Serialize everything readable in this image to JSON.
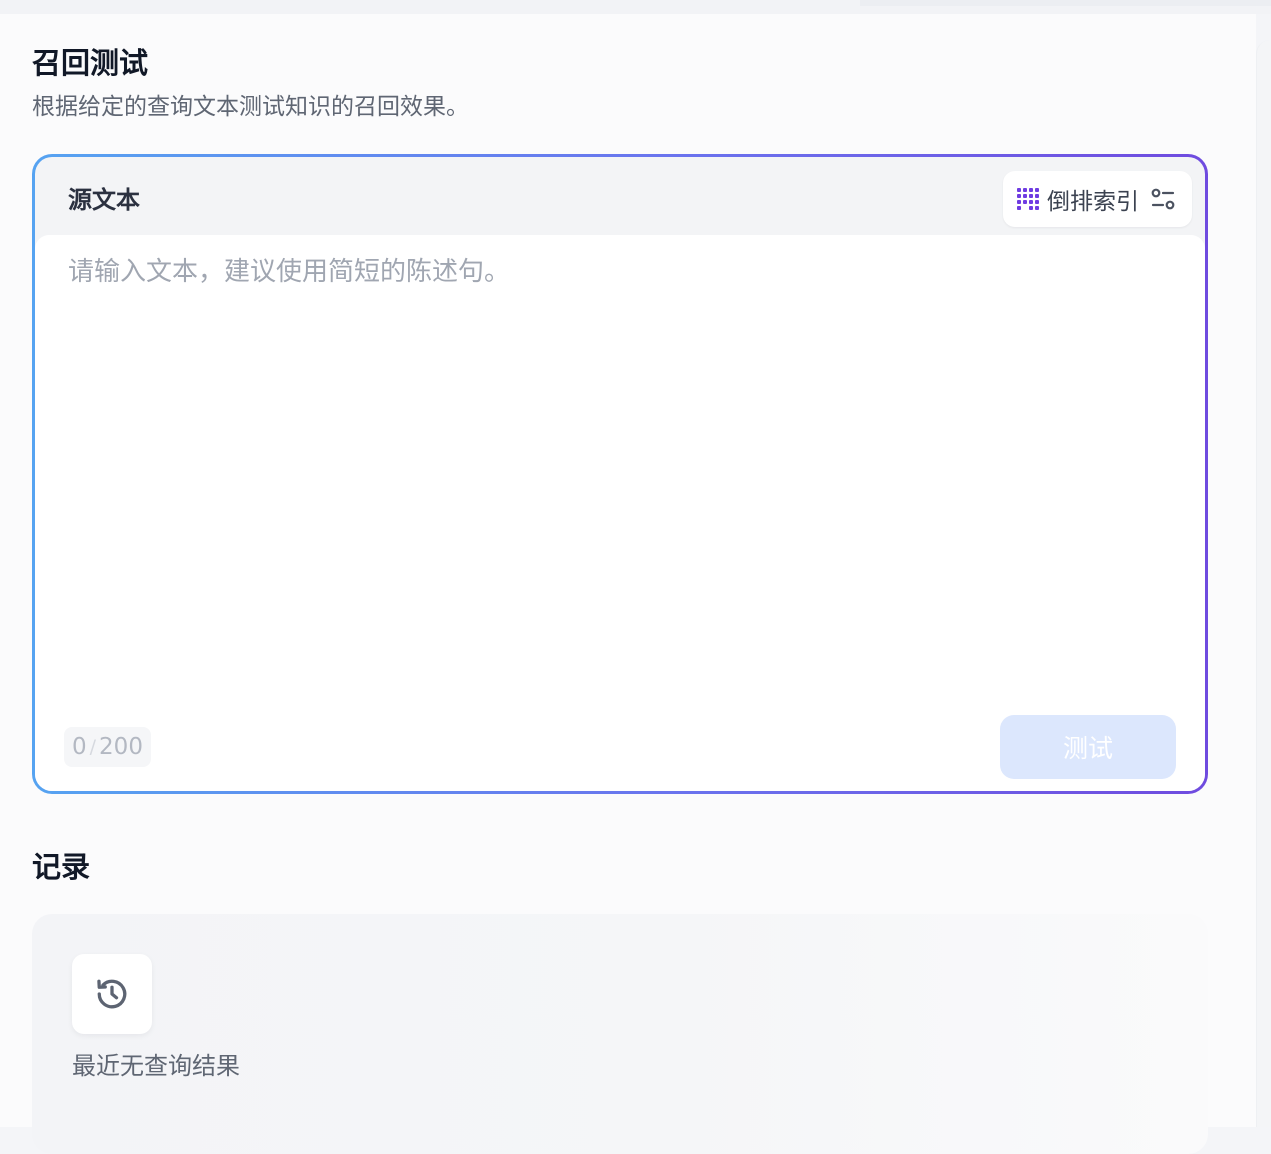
{
  "page": {
    "title": "召回测试",
    "subtitle": "根据给定的查询文本测试知识的召回效果。"
  },
  "source": {
    "label": "源文本",
    "index_mode_label": "倒排索引",
    "index_mode_icon": "grid-icon",
    "settings_icon": "sliders-icon",
    "input": {
      "value": "",
      "placeholder": "请输入文本，建议使用简短的陈述句。"
    },
    "char_count": "0",
    "char_separator": "/",
    "char_limit": "200",
    "test_button_label": "测试"
  },
  "records": {
    "title": "记录",
    "empty_icon": "history-icon",
    "empty_text": "最近无查询结果"
  },
  "colors": {
    "accent_gradient_start": "#56a3f1",
    "accent_gradient_end": "#6f4bdf",
    "index_icon": "#6f3ce2",
    "button_disabled": "#dce7fd"
  }
}
